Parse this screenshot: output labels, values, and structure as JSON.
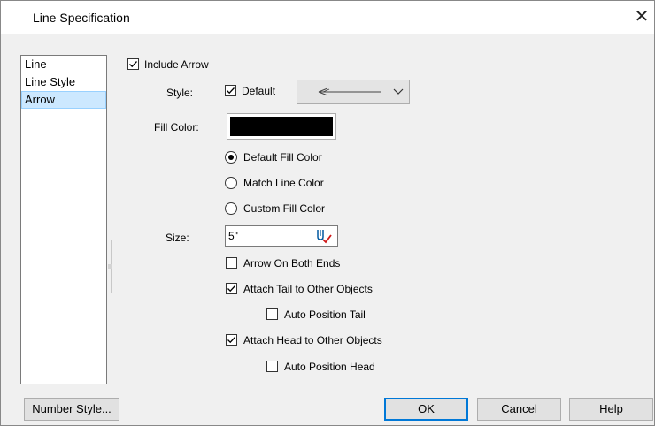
{
  "window": {
    "title": "Line Specification",
    "close_symbol": "✕"
  },
  "nav": {
    "items": [
      {
        "label": "Line",
        "selected": false
      },
      {
        "label": "Line Style",
        "selected": false
      },
      {
        "label": "Arrow",
        "selected": true
      }
    ]
  },
  "arrow": {
    "include_arrow": {
      "label": "Include Arrow",
      "checked": true
    },
    "style": {
      "label": "Style:",
      "default_checkbox": {
        "label": "Default",
        "checked": true
      },
      "preview_icon": "arrow-line-preview-icon",
      "dropdown_icon": "chevron-down-icon"
    },
    "fill_color": {
      "label": "Fill Color:",
      "swatch_color": "#000000",
      "options": [
        {
          "label": "Default Fill Color",
          "selected": true
        },
        {
          "label": "Match Line Color",
          "selected": false
        },
        {
          "label": "Custom Fill Color",
          "selected": false
        }
      ]
    },
    "size": {
      "label": "Size:",
      "value": "5\"",
      "icon": "calculator-icon"
    },
    "arrow_both_ends": {
      "label": "Arrow On Both Ends",
      "checked": false
    },
    "attach_tail": {
      "label": "Attach Tail to Other Objects",
      "checked": true
    },
    "auto_position_tail": {
      "label": "Auto Position Tail",
      "checked": false
    },
    "attach_head": {
      "label": "Attach Head to Other Objects",
      "checked": true
    },
    "auto_position_head": {
      "label": "Auto Position Head",
      "checked": false
    }
  },
  "buttons": {
    "number_style": "Number Style...",
    "ok": "OK",
    "cancel": "Cancel",
    "help": "Help"
  }
}
